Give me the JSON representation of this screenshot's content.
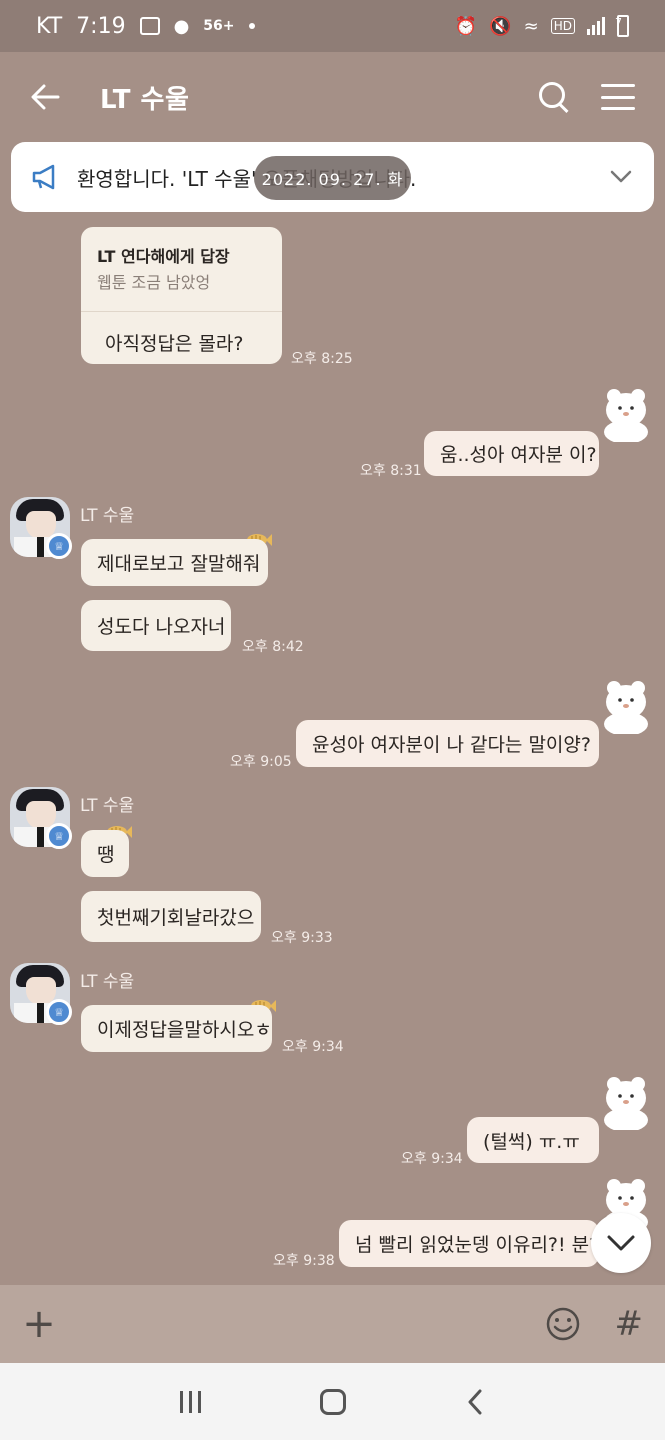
{
  "status_bar": {
    "carrier": "KT",
    "time": "7:19",
    "network": "56+",
    "hd": "HD",
    "battery": "7"
  },
  "header": {
    "title": "LT 수울"
  },
  "notice": {
    "text": "환영합니다. 'LT 수울' 오픈채팅방입니다.",
    "date": "2022. 09. 27. 화"
  },
  "messages": [
    {
      "reply_title": "LT 연다해에게 답장",
      "reply_snippet": "웹툰 조금 남았엉",
      "text": "아직정답은 몰라?",
      "time": "오후 8:25"
    },
    {
      "text": "움..성아 여자분 이?",
      "time": "오후 8:31"
    },
    {
      "sender": "LT 수울",
      "text": "제대로보고 잘말해줘"
    },
    {
      "text": "성도다 나오자너",
      "time": "오후 8:42"
    },
    {
      "text": "윤성아 여자분이 나 같다는 말이양?",
      "time": "오후 9:05"
    },
    {
      "sender": "LT 수울",
      "text": "땡"
    },
    {
      "text": "첫번째기회날라갔으",
      "time": "오후 9:33"
    },
    {
      "sender": "LT 수울",
      "text": "이제정답을말하시오ㅎ",
      "time": "오후 9:34"
    },
    {
      "text": "(털썩) ㅠ.ㅠ",
      "time": "오후 9:34"
    },
    {
      "text": "넘 빨리 읽었눈뎅 이유리?! 분?",
      "time": "오후 9:38"
    }
  ],
  "composer": {
    "plus": "+",
    "hash": "#"
  },
  "colors": {
    "chat_bg": "#a59087",
    "bubble": "#f5efe6",
    "admin_badge": "#4f8ad1"
  },
  "icons": {
    "back": "arrow-left-icon",
    "search": "search-icon",
    "menu": "hamburger-icon",
    "notice": "megaphone-icon",
    "expand": "chevron-down-icon",
    "emoji": "smiley-icon"
  }
}
